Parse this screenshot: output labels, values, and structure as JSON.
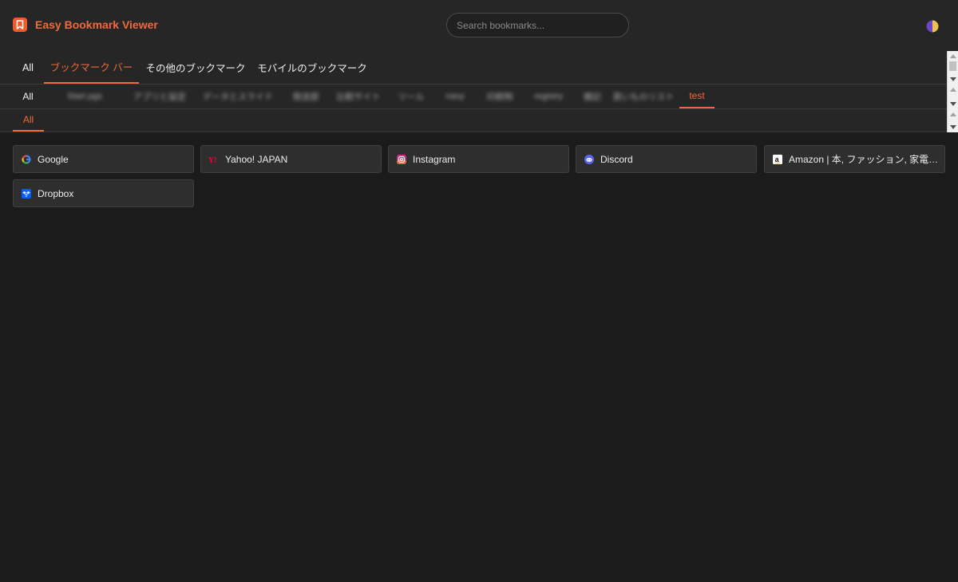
{
  "app": {
    "title": "Easy Bookmark Viewer",
    "logo_icon": "bookmark-icon",
    "accent": "#ef5a2c"
  },
  "search": {
    "placeholder": "Search bookmarks..."
  },
  "theme_toggle": {
    "icon": "half-circle-icon"
  },
  "tabs_level1": [
    {
      "label": "All"
    },
    {
      "label": "ブックマーク バー"
    },
    {
      "label": "その他のブックマーク"
    },
    {
      "label": "モバイルのブックマーク"
    }
  ],
  "tabs_level2": [
    {
      "label": "All"
    },
    {
      "label": "Start pgs"
    },
    {
      "label": "アプリと設定"
    },
    {
      "label": "データとスライド"
    },
    {
      "label": "発送部"
    },
    {
      "label": "比較サイト"
    },
    {
      "label": "ツール"
    },
    {
      "label": "navy"
    },
    {
      "label": "印刷物"
    },
    {
      "label": "registry"
    },
    {
      "label": "雑記"
    },
    {
      "label": "買いものリスト"
    },
    {
      "label": "test"
    }
  ],
  "tabs_level3": [
    {
      "label": "All"
    }
  ],
  "bookmarks": [
    {
      "title": "Google",
      "icon": "google-icon"
    },
    {
      "title": "Yahoo! JAPAN",
      "icon": "yahoo-icon"
    },
    {
      "title": "Instagram",
      "icon": "instagram-icon"
    },
    {
      "title": "Discord",
      "icon": "discord-icon"
    },
    {
      "title": "Amazon | 本, ファッション, 家電から食品まで",
      "icon": "amazon-icon"
    },
    {
      "title": "Dropbox",
      "icon": "dropbox-icon"
    }
  ]
}
